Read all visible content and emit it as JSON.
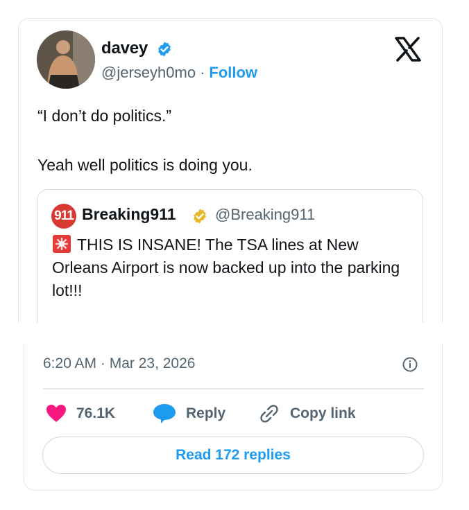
{
  "author": {
    "name": "davey",
    "handle": "@jerseyh0mo",
    "separator": "·",
    "follow_label": "Follow"
  },
  "tweet": {
    "line1": "“I don’t do politics.”",
    "line2": "Yeah well politics is doing you."
  },
  "quoted": {
    "avatar_text": "911",
    "name": "Breaking911",
    "handle": "@Breaking911",
    "text": "THIS IS INSANE! The TSA lines at New Orleans Airport is now backed up into the parking lot!!!"
  },
  "meta": {
    "timestamp": "6:20 AM · Mar 23, 2026"
  },
  "actions": {
    "likes": "76.1K",
    "reply_label": "Reply",
    "copy_label": "Copy link"
  },
  "read_replies_label": "Read 172 replies",
  "colors": {
    "accent": "#1d9bf0",
    "like": "#f91880",
    "muted_text": "#536471",
    "border": "#e1e6ea",
    "gold_badge": "#e8b829"
  },
  "icons": [
    "verified-badge-icon",
    "x-logo-icon",
    "gold-verified-badge-icon",
    "siren-emoji-icon",
    "info-icon",
    "heart-icon",
    "reply-bubble-icon",
    "link-icon"
  ]
}
